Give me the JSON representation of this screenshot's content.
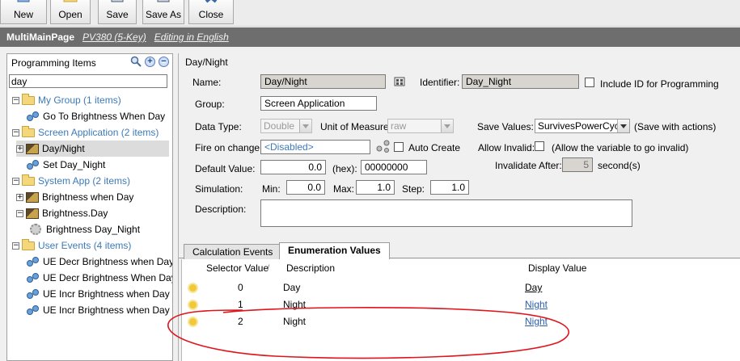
{
  "toolbar": {
    "new": "New",
    "open": "Open",
    "save": "Save",
    "save_as": "Save As",
    "close": "Close"
  },
  "titlebar": {
    "title": "MultiMainPage",
    "device": "PV380 (5-Key)",
    "language": "Editing in English"
  },
  "left": {
    "heading": "Programming Items",
    "search_value": "day",
    "tree": [
      {
        "label": "My Group (1 items)"
      },
      {
        "label": "Go To Brightness When Day"
      },
      {
        "label": "Screen Application (2 items)"
      },
      {
        "label": "Day/Night"
      },
      {
        "label": "Set Day_Night"
      },
      {
        "label": "System App (2 items)"
      },
      {
        "label": "Brightness when Day"
      },
      {
        "label": "Brightness.Day"
      },
      {
        "label": "Brightness Day_Night"
      },
      {
        "label": "User Events (4 items)"
      },
      {
        "label": "UE Decr Brightness when Day"
      },
      {
        "label": "UE Decr Brightness When Day b"
      },
      {
        "label": "UE Incr Brightness when Day"
      },
      {
        "label": "UE Incr Brightness when Day by"
      }
    ]
  },
  "form": {
    "header": "Day/Night",
    "name_label": "Name:",
    "name_value": "Day/Night",
    "identifier_label": "Identifier:",
    "identifier_value": "Day_Night",
    "include_id_label": "Include ID for Programming",
    "group_label": "Group:",
    "group_value": "Screen Application",
    "data_type_label": "Data Type:",
    "data_type_value": "Double",
    "uom_label": "Unit of Measure:",
    "uom_value": "raw",
    "save_values_label": "Save Values:",
    "save_values_value": "SurvivesPowerCycle",
    "save_values_note": "(Save with actions)",
    "fire_label": "Fire on change:",
    "fire_value": "<Disabled>",
    "auto_create_label": "Auto Create",
    "allow_invalid_label": "Allow Invalid:",
    "allow_invalid_note": "(Allow the variable to go invalid)",
    "default_label": "Default Value:",
    "default_value": "0.0",
    "hex_label": "(hex):",
    "hex_value": "00000000",
    "invalidate_label": "Invalidate After:",
    "invalidate_value": "5",
    "invalidate_unit": "second(s)",
    "simulation_label": "Simulation:",
    "min_label": "Min:",
    "min_value": "0.0",
    "max_label": "Max:",
    "max_value": "1.0",
    "step_label": "Step:",
    "step_value": "1.0",
    "description_label": "Description:",
    "description_value": ""
  },
  "tabs": [
    "Calculation Events",
    "Enumeration Values"
  ],
  "grid": {
    "headers": {
      "selector": "Selector Value",
      "sort_glyph": "/",
      "description": "Description",
      "display": "Display Value"
    },
    "rows": [
      {
        "selector": "0",
        "description": "Day",
        "display": "Day"
      },
      {
        "selector": "1",
        "description": "Night",
        "display": "Night"
      },
      {
        "selector": "2",
        "description": "Night",
        "display": "Night"
      }
    ]
  },
  "colors": {
    "titlebar": "#6e6e6e",
    "group_text": "#3d7ab8",
    "link": "#2a5db0",
    "annotation": "#e0141b"
  },
  "icons": [
    "new-icon",
    "open-icon",
    "save-icon",
    "save-as-icon",
    "close-icon",
    "search-icon",
    "add-icon",
    "remove-icon",
    "folder-icon",
    "event-icon",
    "screen-icon",
    "gear-icon",
    "browse-icon",
    "link-icon"
  ]
}
